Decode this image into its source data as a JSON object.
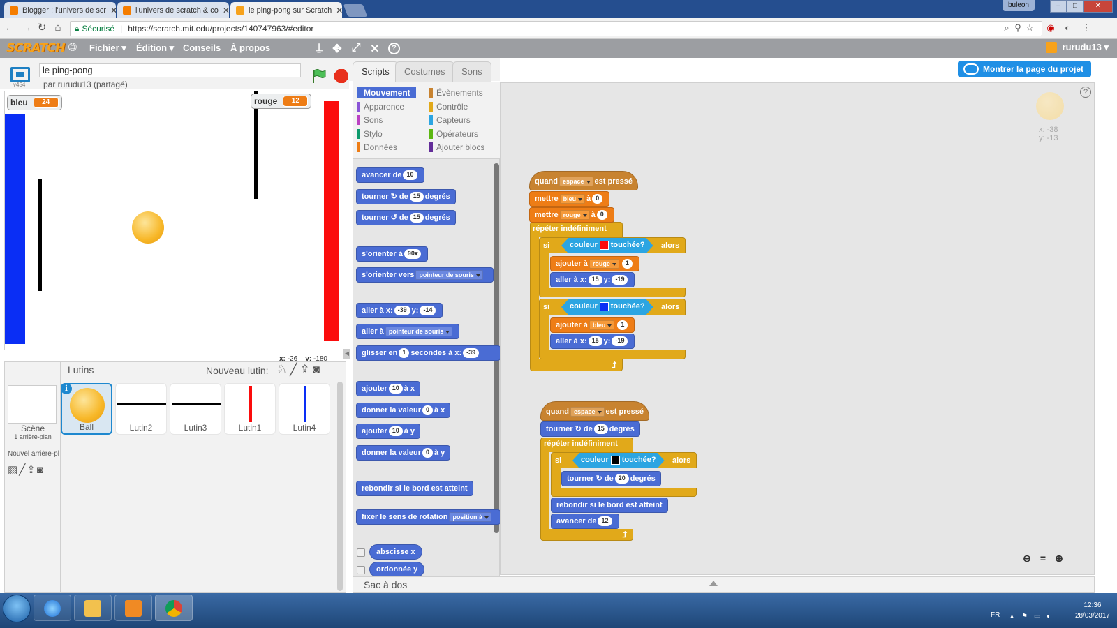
{
  "browser": {
    "tabs": [
      {
        "label": "Blogger : l'univers de scr",
        "active": false,
        "favicon": "blogger-icon"
      },
      {
        "label": "l'univers de scratch & co",
        "active": false,
        "favicon": "blogger-icon"
      },
      {
        "label": "le ping-pong sur Scratch",
        "active": true,
        "favicon": "scratch-icon"
      }
    ],
    "close_glyph": "✕",
    "window_user": "buleon",
    "secure_label": "Sécurisé",
    "url": "https://scratch.mit.edu/projects/140747963/#editor"
  },
  "scratch_menu": {
    "logo": "SCRATCH",
    "items": [
      "Fichier ▾",
      "Édition ▾",
      "Conseils",
      "À propos"
    ],
    "user": "rurudu13 ▾"
  },
  "project": {
    "title": "le ping-pong",
    "author": "par rurudu13 (partagé)",
    "version": "v454"
  },
  "stage": {
    "watchers": [
      {
        "name": "bleu",
        "value": "24"
      },
      {
        "name": "rouge",
        "value": "12"
      }
    ],
    "coords_x_label": "x:",
    "coords_x": "-26",
    "coords_y_label": "y:",
    "coords_y": "-180",
    "colors": {
      "blue": "#0a2ef5",
      "red": "#fb0c0c",
      "black": "#000000",
      "ball": "#f7b728"
    }
  },
  "sprites_panel": {
    "title": "Lutins",
    "new_sprite": "Nouveau lutin:",
    "scene_label": "Scène",
    "scene_sub": "1 arrière-plan",
    "new_backdrop": "Nouvel arrière-pl",
    "info_glyph": "i",
    "sprites": [
      {
        "name": "Ball",
        "selected": true
      },
      {
        "name": "Lutin2",
        "selected": false
      },
      {
        "name": "Lutin3",
        "selected": false
      },
      {
        "name": "Lutin1",
        "selected": false
      },
      {
        "name": "Lutin4",
        "selected": false
      }
    ]
  },
  "editor_tabs": [
    "Scripts",
    "Costumes",
    "Sons"
  ],
  "categories": [
    {
      "label": "Mouvement",
      "color": "#4a6cd4",
      "active": true
    },
    {
      "label": "Apparence",
      "color": "#8a55d7"
    },
    {
      "label": "Sons",
      "color": "#bb42c3"
    },
    {
      "label": "Stylo",
      "color": "#0e9a6c"
    },
    {
      "label": "Données",
      "color": "#ee7d16"
    },
    {
      "label": "Évènements",
      "color": "#c88330"
    },
    {
      "label": "Contrôle",
      "color": "#e1a91a"
    },
    {
      "label": "Capteurs",
      "color": "#2ca5e2"
    },
    {
      "label": "Opérateurs",
      "color": "#5cb712"
    },
    {
      "label": "Ajouter blocs",
      "color": "#632d99"
    }
  ],
  "palette": {
    "move": {
      "t1": "avancer de",
      "v": "10"
    },
    "turn_right": {
      "t1": "tourner",
      "t2": "de",
      "v": "15",
      "t3": "degrés"
    },
    "turn_left": {
      "t1": "tourner",
      "t2": "de",
      "v": "15",
      "t3": "degrés"
    },
    "point_dir": {
      "t1": "s'orienter à",
      "v": "90▾"
    },
    "point_towards": {
      "t1": "s'orienter vers",
      "v": "pointeur de souris"
    },
    "goto_xy": {
      "t1": "aller à x:",
      "x": "-39",
      "t2": "y:",
      "y": "-14"
    },
    "goto": {
      "t1": "aller à",
      "v": "pointeur de souris"
    },
    "glide": {
      "t1": "glisser en",
      "v": "1",
      "t2": "secondes à x:",
      "x": "-39"
    },
    "change_x": {
      "t1": "ajouter",
      "v": "10",
      "t2": "à x"
    },
    "set_x": {
      "t1": "donner la valeur",
      "v": "0",
      "t2": "à x"
    },
    "change_y": {
      "t1": "ajouter",
      "v": "10",
      "t2": "à y"
    },
    "set_y": {
      "t1": "donner la valeur",
      "v": "0",
      "t2": "à y"
    },
    "bounce": {
      "t1": "rebondir si le bord est atteint"
    },
    "rotation": {
      "t1": "fixer le sens de rotation",
      "v": "position à"
    },
    "xpos": "abscisse x",
    "ypos": "ordonnée y"
  },
  "script1": {
    "hat": {
      "t1": "quand",
      "key": "espace",
      "t2": "est pressé"
    },
    "set1": {
      "t1": "mettre",
      "var": "bleu",
      "t2": "à",
      "v": "0"
    },
    "set2": {
      "t1": "mettre",
      "var": "rouge",
      "t2": "à",
      "v": "0"
    },
    "forever": "répéter indéfiniment",
    "if1": {
      "t1": "si",
      "s1": "couleur",
      "color": "#fb0c0c",
      "s2": "touchée?",
      "t2": "alors"
    },
    "add1": {
      "t1": "ajouter",
      "t2": "à",
      "var": "rouge",
      "v": "1"
    },
    "goto1": {
      "t1": "aller à x:",
      "x": "15",
      "t2": "y:",
      "y": "-19"
    },
    "if2": {
      "t1": "si",
      "s1": "couleur",
      "color": "#0a2ef5",
      "s2": "touchée?",
      "t2": "alors"
    },
    "add2": {
      "t1": "ajouter",
      "t2": "à",
      "var": "bleu",
      "v": "1"
    },
    "goto2": {
      "t1": "aller à x:",
      "x": "15",
      "t2": "y:",
      "y": "-19"
    }
  },
  "script2": {
    "hat": {
      "t1": "quand",
      "key": "espace",
      "t2": "est pressé"
    },
    "turn": {
      "t1": "tourner",
      "t2": "de",
      "v": "15",
      "t3": "degrés"
    },
    "forever": "répéter indéfiniment",
    "if1": {
      "t1": "si",
      "s1": "couleur",
      "color": "#000000",
      "s2": "touchée?",
      "t2": "alors"
    },
    "turn2": {
      "t1": "tourner",
      "t2": "de",
      "v": "20",
      "t3": "degrés"
    },
    "bounce": "rebondir si le bord est atteint",
    "move": {
      "t1": "avancer de",
      "v": "12"
    }
  },
  "show_project": "Montrer la page du projet",
  "help_glyph": "?",
  "sprite_xy": {
    "x": "x: -38",
    "y": "y: -13"
  },
  "backpack": "Sac à dos",
  "taskbar": {
    "lang": "FR",
    "time": "12:36",
    "date": "28/03/2017"
  }
}
